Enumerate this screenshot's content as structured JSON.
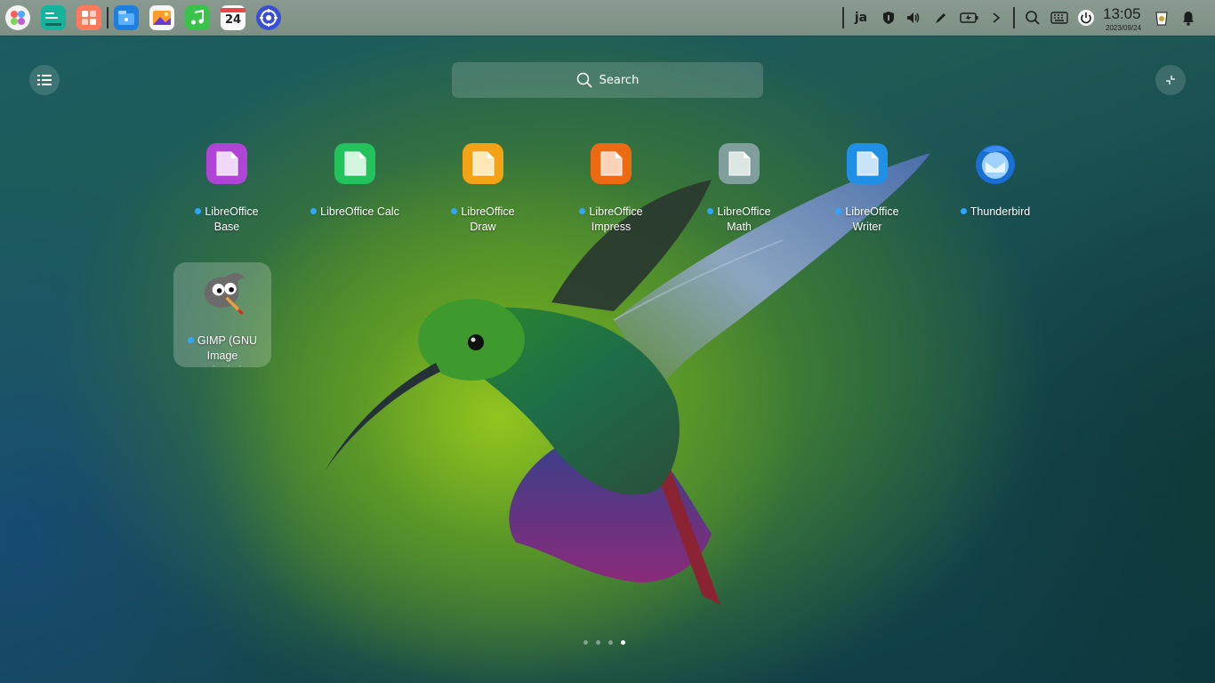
{
  "taskbar": {
    "pinned_icons": [
      "launcher-icon",
      "terminal-icon",
      "multitask-view-icon",
      "file-manager-icon",
      "image-viewer-icon",
      "music-icon",
      "calendar-icon",
      "settings-icon"
    ],
    "calendar_day": "24",
    "input_method": "ja",
    "clock_time": "13:05",
    "clock_date": "2023/09/24",
    "tray_icons": [
      "security-icon",
      "volume-icon",
      "pen-icon",
      "battery-icon",
      "expand-tray-icon",
      "search-icon",
      "keyboard-icon",
      "power-icon",
      "trash-icon",
      "notification-bell-icon"
    ]
  },
  "launcher": {
    "search_placeholder": "Search",
    "apps": [
      {
        "label": "LibreOffice Base",
        "color": "#b044d6",
        "new": true
      },
      {
        "label": "LibreOffice Calc",
        "color": "#22c35c",
        "new": true
      },
      {
        "label": "LibreOffice Draw",
        "color": "#f2a214",
        "new": true
      },
      {
        "label": "LibreOffice Impress",
        "color": "#ee6a12",
        "new": true
      },
      {
        "label": "LibreOffice Math",
        "color": "#7f9e9c",
        "new": true
      },
      {
        "label": "LibreOffice Writer",
        "color": "#1f90e6",
        "new": true
      },
      {
        "label": "Thunderbird",
        "color": "#1a6fd6",
        "new": true
      },
      {
        "label": "GIMP (GNU Image Manipulation Program)",
        "color": "#6b6b6b",
        "new": true,
        "selected": true
      }
    ],
    "page_count": 4,
    "active_page": 4
  }
}
